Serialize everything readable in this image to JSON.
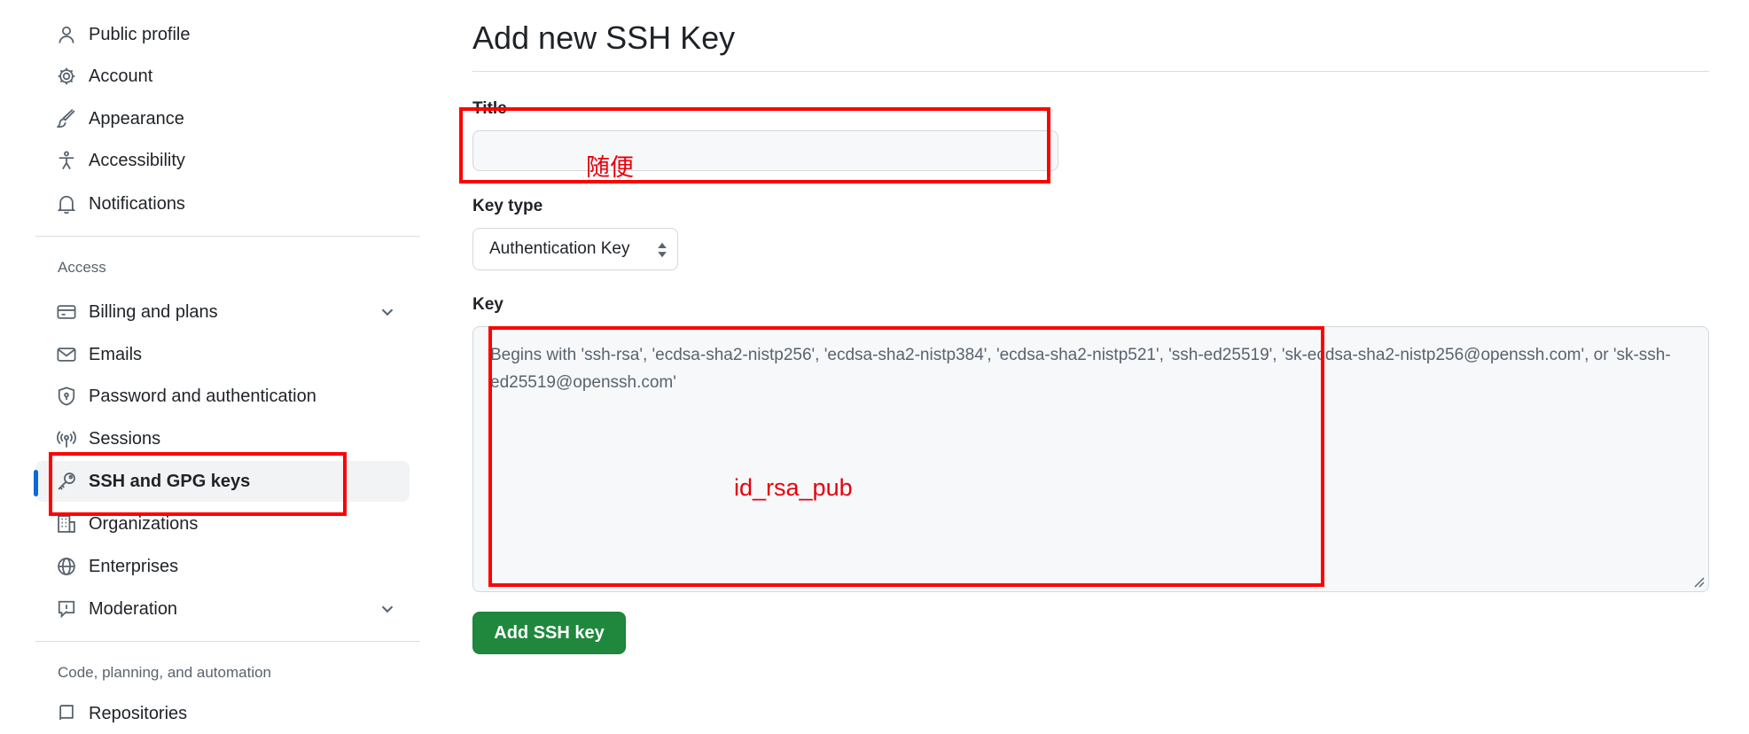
{
  "sidebar": {
    "items": [
      {
        "label": "Public profile",
        "icon": "person-icon"
      },
      {
        "label": "Account",
        "icon": "gear-icon"
      },
      {
        "label": "Appearance",
        "icon": "paintbrush-icon"
      },
      {
        "label": "Accessibility",
        "icon": "accessibility-icon"
      },
      {
        "label": "Notifications",
        "icon": "bell-icon"
      }
    ],
    "access_heading": "Access",
    "access_items": [
      {
        "label": "Billing and plans",
        "icon": "credit-card-icon",
        "expandable": true
      },
      {
        "label": "Emails",
        "icon": "mail-icon"
      },
      {
        "label": "Password and authentication",
        "icon": "shield-lock-icon"
      },
      {
        "label": "Sessions",
        "icon": "broadcast-icon"
      },
      {
        "label": "SSH and GPG keys",
        "icon": "key-icon",
        "active": true
      },
      {
        "label": "Organizations",
        "icon": "organization-icon"
      },
      {
        "label": "Enterprises",
        "icon": "globe-icon"
      },
      {
        "label": "Moderation",
        "icon": "report-icon",
        "expandable": true
      }
    ],
    "code_heading": "Code, planning, and automation",
    "code_items": [
      {
        "label": "Repositories",
        "icon": "repo-icon"
      }
    ]
  },
  "main": {
    "title": "Add new SSH Key",
    "title_field": {
      "label": "Title",
      "value": ""
    },
    "key_type": {
      "label": "Key type",
      "selected": "Authentication Key"
    },
    "key_field": {
      "label": "Key",
      "placeholder": "Begins with 'ssh-rsa', 'ecdsa-sha2-nistp256', 'ecdsa-sha2-nistp384', 'ecdsa-sha2-nistp521', 'ssh-ed25519', 'sk-ecdsa-sha2-nistp256@openssh.com', or 'sk-ssh-ed25519@openssh.com'"
    },
    "submit_label": "Add SSH key"
  },
  "annotations": {
    "title_note": "随便",
    "key_note": "id_rsa_pub",
    "color": "#ff0000"
  },
  "colors": {
    "accent": "#0969da",
    "primary_button": "#1f883d"
  }
}
